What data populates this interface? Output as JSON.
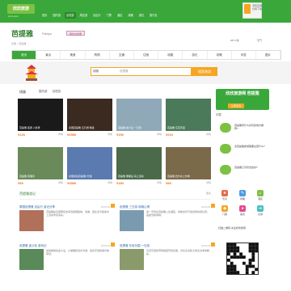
{
  "header": {
    "logo": "欣欣旅游",
    "logo_sub": "cncn.com",
    "nav": [
      "首页",
      "国内游",
      "出境游",
      "周边游",
      "自由行",
      "门票",
      "酒店",
      "攻略",
      "游记",
      "旅行社"
    ],
    "nav_active": 2,
    "app_title": "手机应用",
    "app_sub": "扫码下载"
  },
  "city": {
    "name": "芭提雅",
    "en": "Pattaya",
    "button": "我去过这里",
    "meta": "泰国 > 芭提雅",
    "weather": "28°C 晴",
    "weather2": "天气"
  },
  "tabs": [
    "首页",
    "景点",
    "美食",
    "购物",
    "交通",
    "住宿",
    "线路",
    "游记",
    "攻略",
    "问答",
    "图片"
  ],
  "tab_active": 0,
  "search": {
    "select": "线路",
    "placeholder": "芭提雅",
    "button": "搜索旅游"
  },
  "products": {
    "title": "线路",
    "tabs": [
      "国内游",
      "出境游"
    ],
    "cards": [
      {
        "caption": "芭提雅 夜游 人妖秀",
        "price": "¥120",
        "color": "#1a1a1a"
      },
      {
        "caption": "泰国芭提雅 五日游 精选",
        "price": "¥2980",
        "color": "#3a2a20"
      },
      {
        "caption": "芭提雅 金沙岛 一日游",
        "price": "¥150",
        "color": "#8fa9b8"
      },
      {
        "caption": "芭提雅 东芭乐园",
        "price": "¥210",
        "color": "#4a7a5a"
      },
      {
        "caption": "芭提雅 真理寺",
        "price": "¥99",
        "color": "#6a8a5a"
      },
      {
        "caption": "泰国曼谷芭提雅7日游",
        "price": "¥3580",
        "color": "#5a7ab0"
      },
      {
        "caption": "芭提雅 珊瑚岛 海上活动",
        "price": "¥180",
        "color": "#4a6a4a"
      },
      {
        "caption": "芭提雅 四方水上市场",
        "price": "¥88",
        "color": "#7a6a4a"
      }
    ],
    "more": "详情"
  },
  "sidebar": {
    "promo_title": "欣欣旅游网 芭提雅",
    "promo_btn": "立即咨询",
    "q_title": "问答",
    "qs": [
      {
        "text": "芭提雅有什么好玩的地方推荐?"
      },
      {
        "text": "去芭提雅旅游需要注意什么?"
      },
      {
        "text": "芭提雅几月份去最好?"
      }
    ],
    "icons": [
      {
        "label": "景点",
        "color": "#e86a4a",
        "glyph": "★"
      },
      {
        "label": "攻略",
        "color": "#4a9ae8",
        "glyph": "✎"
      },
      {
        "label": "酒店",
        "color": "#7dc143",
        "glyph": "⌂"
      },
      {
        "label": "门票",
        "color": "#f5a623",
        "glyph": "◆"
      },
      {
        "label": "美食",
        "color": "#e84a8a",
        "glyph": "●"
      },
      {
        "label": "交通",
        "color": "#4ac0c0",
        "glyph": "➜"
      }
    ],
    "qr_title": "扫描二维码 关注欣欣旅游"
  },
  "news": {
    "title": "芭提雅游记",
    "more": "更多",
    "articles": [
      {
        "h": "泰国芭提雅 自由行 游记分享",
        "d": "芭提雅是泰国著名的海滨度假胜地，海滩、夜生活与各类水上活动丰富多彩。",
        "dt": "2015-06",
        "color": "#b0705a"
      },
      {
        "h": "芭提雅 三日游 攻略心得",
        "d": "第一天到达芭提雅入住酒店，傍晚去步行街感受热闹氛围，品尝当地海鲜。",
        "dt": "2015-05",
        "color": "#7a9ab0"
      },
      {
        "h": "芭提雅 金沙岛 游玩记",
        "d": "坐快艇前往金沙岛，沙滩细腻海水清澈，适合浮潜和拖伞等项目。",
        "dt": "2015-04",
        "color": "#5a8a5a"
      },
      {
        "h": "芭提雅 东芭乐园 一日游",
        "d": "东芭乐园热带植物园景色优美，文化表演和大象表演非常精彩。",
        "dt": "2015-03",
        "color": "#8a9a6a"
      }
    ]
  }
}
